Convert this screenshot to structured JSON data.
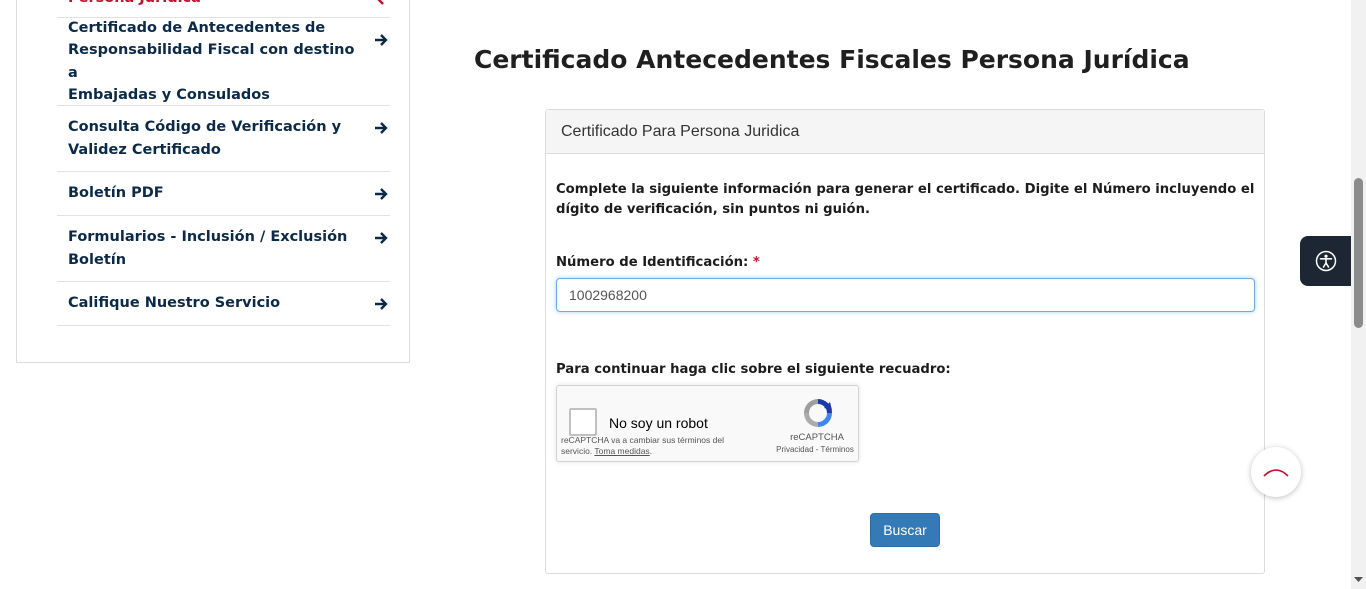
{
  "sidebar": {
    "items": [
      {
        "label": "Persona Jurídica",
        "lines": [
          "Persona Jurídica"
        ],
        "active": true
      },
      {
        "label": "Certificado de Antecedentes de Responsabilidad Fiscal con destino a Embajadas y Consulados",
        "lines": [
          "Certificado de Antecedentes de",
          "Responsabilidad Fiscal con destino a",
          "Embajadas y Consulados"
        ]
      },
      {
        "label": "Consulta Código de Verificación y Validez Certificado",
        "lines": [
          "Consulta Código de Verificación y",
          "Validez Certificado"
        ]
      },
      {
        "label": "Boletín PDF",
        "lines": [
          "Boletín PDF"
        ]
      },
      {
        "label": "Formularios - Inclusión / Exclusión Boletín",
        "lines": [
          "Formularios - Inclusión / Exclusión",
          "Boletín"
        ]
      },
      {
        "label": "Califique Nuestro Servicio",
        "lines": [
          "Califique Nuestro Servicio"
        ]
      }
    ],
    "arrow_icon": "arrow-right-icon",
    "text_color": "#0b2a4a",
    "active_color": "#c8102e"
  },
  "main": {
    "title": "Certificado Antecedentes Fiscales Persona Jurídica",
    "card": {
      "header": "Certificado Para Persona Juridica",
      "instructions": "Complete la siguiente información para generar el certificado. Digite el Número incluyendo el dígito de verificación, sin puntos ni guión.",
      "id_label": "Número de Identificación:",
      "required_mark": "*",
      "id_value": "1002968200",
      "captcha_prompt": "Para continuar haga clic sobre el siguiente recuadro:",
      "recaptcha": {
        "checkbox_label": "No soy un robot",
        "notice_prefix": "reCAPTCHA va a cambiar sus términos del servicio.",
        "notice_link": "Toma medidas",
        "notice_suffix": ".",
        "brand": "reCAPTCHA",
        "links": "Privacidad - Términos"
      },
      "submit_label": "Buscar"
    }
  },
  "widgets": {
    "accessibility_icon": "accessibility-icon",
    "back_to_top_icon": "chevron-up-icon"
  },
  "colors": {
    "primary_button": "#337ab7",
    "accent_red": "#c8102e",
    "accessibility_bg": "#1d2733"
  }
}
